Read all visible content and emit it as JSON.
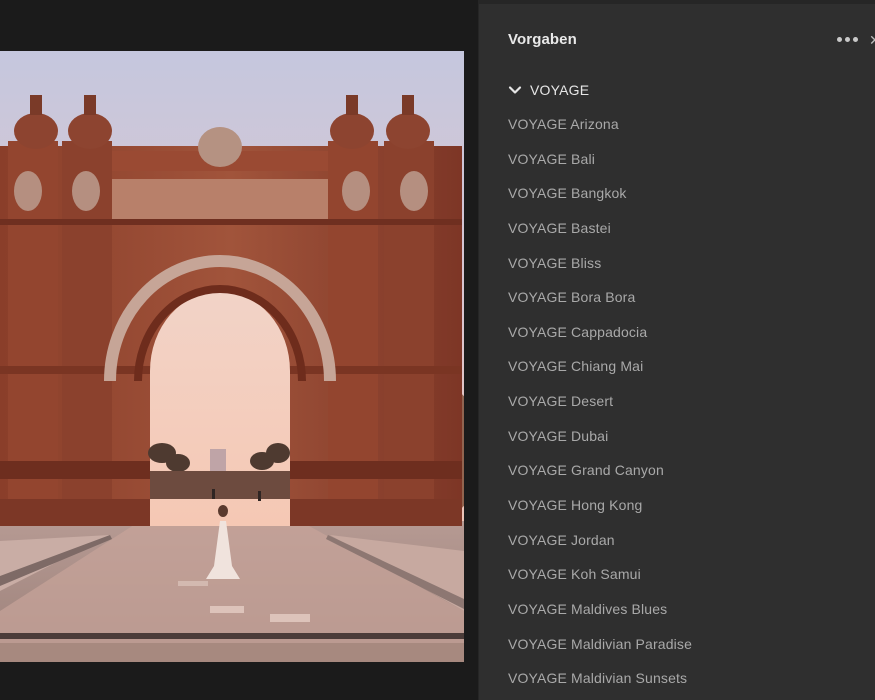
{
  "panel": {
    "title": "Vorgaben",
    "more_icon": "more-horizontal-icon",
    "close_glyph": "✕",
    "group": {
      "label": "VOYAGE",
      "icon": "chevron-down-icon",
      "expanded": true
    },
    "presets": [
      {
        "label": "VOYAGE Arizona"
      },
      {
        "label": "VOYAGE Bali"
      },
      {
        "label": "VOYAGE Bangkok"
      },
      {
        "label": "VOYAGE Bastei"
      },
      {
        "label": "VOYAGE Bliss"
      },
      {
        "label": "VOYAGE Bora Bora"
      },
      {
        "label": "VOYAGE Cappadocia"
      },
      {
        "label": "VOYAGE Chiang Mai"
      },
      {
        "label": "VOYAGE Desert"
      },
      {
        "label": "VOYAGE Dubai"
      },
      {
        "label": "VOYAGE Grand Canyon"
      },
      {
        "label": "VOYAGE Hong Kong"
      },
      {
        "label": "VOYAGE Jordan"
      },
      {
        "label": "VOYAGE Koh Samui"
      },
      {
        "label": "VOYAGE Maldives Blues"
      },
      {
        "label": "VOYAGE Maldivian Paradise"
      },
      {
        "label": "VOYAGE Maldivian Sunsets"
      }
    ]
  },
  "colors": {
    "panel_bg": "#2f2f2f",
    "canvas_bg": "#1b1b1b",
    "title_text": "#e9e9e9",
    "item_text": "#a9a9a9"
  }
}
